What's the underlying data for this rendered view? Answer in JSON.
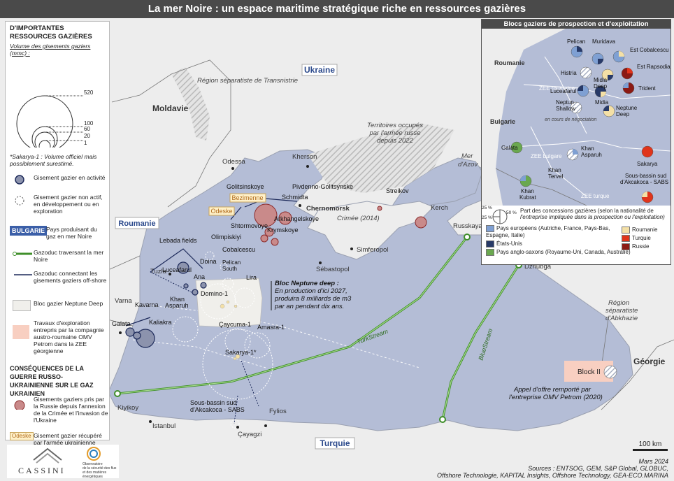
{
  "title": "La mer Noire : un espace maritime stratégique riche en ressources gazières",
  "countries": {
    "ukraine": "Ukraine",
    "moldavie": "Moldavie",
    "roumanie": "Roumanie",
    "bulgarie": "Bulgarie",
    "turquie": "Turquie",
    "georgie": "Géorgie"
  },
  "regions": {
    "transnistrie": "Région séparatiste de Transnistrie",
    "occupied_1": "Territoires occupés",
    "occupied_2": "par l'armée russe",
    "occupied_3": "depuis 2022",
    "crimee": "Crimée (2014)",
    "azov_1": "Mer",
    "azov_2": "d'Azov",
    "abkhazie_1": "Région",
    "abkhazie_2": "séparatiste",
    "abkhazie_3": "d'Abkhazie"
  },
  "cities": {
    "odessa": "Odessa",
    "kherson": "Kherson",
    "chernomorsk": "Chernomorsk",
    "simferopol": "Simferopol",
    "sebastopol": "Sébastopol",
    "kerch": "Kerch",
    "russkaya": "Russkaya",
    "dzhubga": "Dzhubga",
    "tuzla": "Tuzla",
    "varna": "Varna",
    "kiyikoy": "Kiyikoy",
    "istanbul": "Istanbul",
    "fylios": "Fylios",
    "cayagzi": "Çayagzi"
  },
  "fields": {
    "golitsinskoye": "Golitsinskoye",
    "pivdenno": "Pivdenno-Golitsynske",
    "schmidta": "Schmidta",
    "bezimenne": "Bezimenne",
    "odeske": "Odeske",
    "arkhangelskoye": "Arkhangelskoye",
    "shtormovoye": "Shtormovoye",
    "krymskoye": "Krymskoye",
    "streikov": "Streikov",
    "kerch": "Kerch",
    "lebada": "Lebada fields",
    "olimpiskiyi": "Olimpiskiyi",
    "cobalcescu": "Cobalcescu",
    "doina": "Doina",
    "ana": "Ana",
    "luceafarul": "Luceafarul",
    "pelican_south_1": "Pelican",
    "pelican_south_2": "South",
    "lira": "Lira",
    "domino": "Domino-1",
    "kavarna": "Kavarna",
    "galata": "Galata",
    "kaliakra": "Kaliakra",
    "khan_asparuh_1": "Khan",
    "khan_asparuh_2": "Asparuh",
    "caycuma": "Çaycuma-1",
    "amasra": "Amasra-1",
    "sakarya": "Sakarya-1*",
    "sabs_1": "Sous-bassin sud",
    "sabs_2": "d'Akcakoca - SABS",
    "block2": "Block II"
  },
  "pipelines": {
    "turkstream": "TurkStream",
    "bluestream": "BlueStream"
  },
  "annotations": {
    "neptune_title": "Bloc Neptune deep :",
    "neptune_1": "En production d'ici 2027,",
    "neptune_2": "produira 8 milliards de m3",
    "neptune_3": "par an pendant dix ans.",
    "omv_1": "Appel d'offre remporté par",
    "omv_2": "l'entreprise OMV Petrom (2020)"
  },
  "legend": {
    "h1": "D'importantes ressources gazières",
    "vol_label": "Volume des gisements gaziers (mmc) :",
    "vol_values": [
      "520",
      "100",
      "60",
      "20",
      "1"
    ],
    "sakarya_note": "*Sakarya-1 : Volume officiel mais possiblement surestimé.",
    "active": "Gisement gazier en activité",
    "inactive": "Gisement gazier non actif, en développement ou en exploration",
    "bulgaria_tag": "Bulgarie",
    "producers": "Pays produisant du gaz en mer Noire",
    "pipeline_sea": "Gazoduc traversant la mer Noire",
    "pipeline_off": "Gazoduc connectant les gisements gaziers off-shore",
    "neptune_block": "Bloc gazier Neptune Deep",
    "omv_works": "Travaux d'exploration entrepris par la compagnie austro-roumaine OMV Petrom dans la ZEE géorgienne",
    "h2": "Conséquences de la guerre russo-ukrainienne sur le gaz ukrainien",
    "taken": "Gisements gaziers pris par la Russie depuis l'annexion de la Crimée et l'invasion de l'Ukraine",
    "odeske_tag": "Odeske",
    "recovered": "Gisement gazier récupéré par l'armée ukrainienne"
  },
  "inset": {
    "title": "Blocs gaziers de prospection et d'exploitation",
    "roumanie": "Roumanie",
    "bulgarie": "Bulgarie",
    "zee_roumaine": "ZEE roumaine",
    "zee_bulgare": "ZEE bulgare",
    "zee_turque": "ZEE turque",
    "negociation": "en cours de négociation",
    "blocks": {
      "pelican": "Pelican",
      "muridava": "Muridava",
      "est_cobalcescu": "Est Cobalcescu",
      "histria": "Histria",
      "midia_deep_1": "Midia",
      "midia_deep_2": "Deep",
      "est_rapsodia": "Est Rapsodia",
      "luceafarul": "Luceafarul",
      "midia": "Midia",
      "trident": "Trident",
      "neptun_shallow_1": "Neptun",
      "neptun_shallow_2": "Shallow",
      "neptune_deep_1": "Neptune",
      "neptune_deep_2": "Deep",
      "galata": "Galata",
      "khan_asparuh_1": "Khan",
      "khan_asparuh_2": "Asparuh",
      "sakarya": "Sakarya",
      "khan_tervel_1": "Khan",
      "khan_tervel_2": "Tervel",
      "khan_kubrat_1": "Khan",
      "khan_kubrat_2": "Kubrat",
      "sabs_1": "Sous-bassin sud",
      "sabs_2": "d'Akcakoca - SABS"
    },
    "pct_25a": "25 %",
    "pct_25b": "25 %",
    "pct_50": "50 %",
    "share_1": "Part des concessions gazières (selon la nationalité de",
    "share_2": "l'entreprise impliquée dans la prospection ou l'exploitation)",
    "leg_europe": "Pays européens (Autriche, France, Pays-Bas, Espagne, Italie)",
    "leg_us": "États-Unis",
    "leg_anglo": "Pays anglo-saxons (Royaume-Uni, Canada, Australie)",
    "leg_roumanie": "Roumanie",
    "leg_turquie": "Turquie",
    "leg_russie": "Russie"
  },
  "colors": {
    "sea": "#b4bdd6",
    "land": "#ededed",
    "europe": "#7fa0d3",
    "us": "#283a68",
    "anglo": "#6aa84f",
    "roumanie": "#f4e0a6",
    "turquie": "#e0341b",
    "russie": "#8b1a14",
    "taken": "#c98a8a",
    "pipeline": "#3f8f2a"
  },
  "scale": "100 km",
  "date": "Mars 2024",
  "sources_1": "Sources : ENTSOG, GEM, S&P Global, GLOBUC,",
  "sources_2": "Offshore Technologie, KAPITAL Insights, Offshore Technology, GEA-ECO.MARINA",
  "logo": {
    "cassini": "CASSINI",
    "obs_1": "Observatoire",
    "obs_2": "de la sécurité des flux",
    "obs_3": "et des matières énergétiques"
  }
}
